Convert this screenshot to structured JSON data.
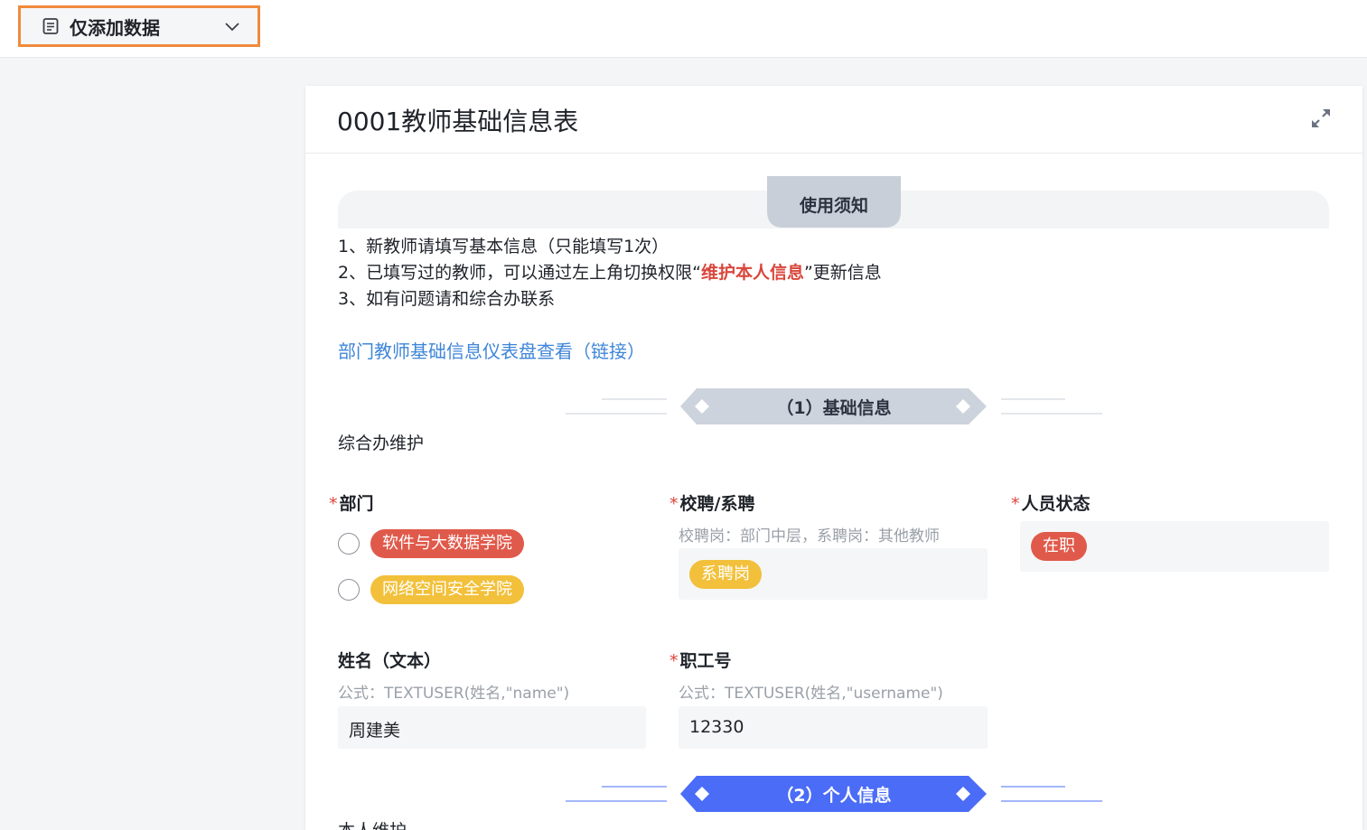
{
  "topbar": {
    "permission_select": {
      "label": "仅添加数据",
      "icon": "document-icon",
      "dropdown_icon": "chevron-down-icon"
    }
  },
  "form": {
    "title": "0001教师基础信息表",
    "expand_icon": "expand-icon",
    "notice": {
      "tab_label": "使用须知",
      "line1": "1、新教师请填写基本信息（只能填写1次）",
      "line2_before": "2、已填写过的教师，可以通过左上角切换权限“",
      "line2_highlight": "维护本人信息",
      "line2_after": "”更新信息",
      "line3": "3、如有问题请和综合办联系"
    },
    "dashboard_link": "部门教师基础信息仪表盘查看（链接）",
    "section1": {
      "label": "（1）基础信息",
      "note": "综合办维护"
    },
    "department": {
      "required": "*",
      "label": "部门",
      "options": [
        {
          "label": "软件与大数据学院",
          "color": "#e05a4b"
        },
        {
          "label": "网络空间安全学院",
          "color": "#f2c03a"
        }
      ]
    },
    "hire_type": {
      "required": "*",
      "label": "校聘/系聘",
      "hint": "校聘岗：部门中层，系聘岗：其他教师",
      "value": "系聘岗",
      "value_color": "#f2c03a"
    },
    "staff_status": {
      "required": "*",
      "label": "人员状态",
      "value": "在职",
      "value_color": "#e05a4b"
    },
    "name_text": {
      "label": "姓名（文本）",
      "hint": "公式：TEXTUSER(姓名,\"name\")",
      "value": "周建美"
    },
    "employee_id": {
      "required": "*",
      "label": "职工号",
      "hint": "公式：TEXTUSER(姓名,\"username\")",
      "value": "12330"
    },
    "section2": {
      "label": "（2）个人信息",
      "note": "本人维护"
    }
  },
  "colors": {
    "accent_orange": "#f08a3c",
    "link_blue": "#3f86d8",
    "section2_blue": "#4a6cf7",
    "highlight_red": "#d9463c"
  }
}
